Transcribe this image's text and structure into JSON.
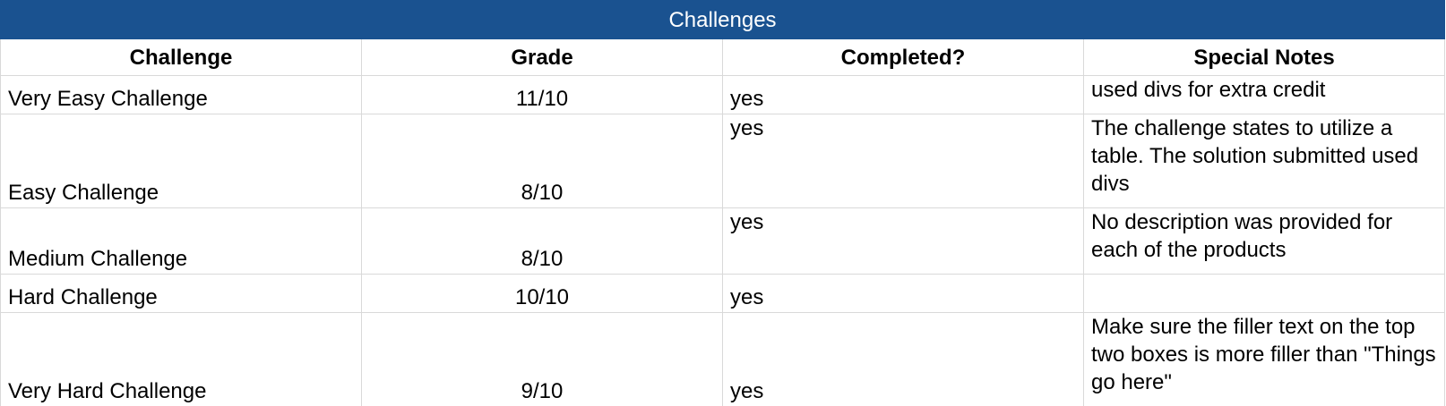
{
  "sheet": {
    "title": "Challenges",
    "title_color": "#1a5290",
    "columns": [
      "Challenge",
      "Grade",
      "Completed?",
      "Special Notes"
    ],
    "rows": [
      {
        "challenge": "Very Easy Challenge",
        "grade": "11/10",
        "completed": "yes",
        "notes": "used divs for extra credit"
      },
      {
        "challenge": "Easy Challenge",
        "grade": "8/10",
        "completed": "yes",
        "notes": "The challenge states to utilize a table. The solution submitted used divs"
      },
      {
        "challenge": "Medium Challenge",
        "grade": "8/10",
        "completed": "yes",
        "notes": "No description was provided for each of the products"
      },
      {
        "challenge": "Hard Challenge",
        "grade": "10/10",
        "completed": "yes",
        "notes": ""
      },
      {
        "challenge": "Very Hard Challenge",
        "grade": "9/10",
        "completed": "yes",
        "notes": "Make sure the filler text on the top two boxes is more filler than \"Things go here\""
      }
    ]
  }
}
